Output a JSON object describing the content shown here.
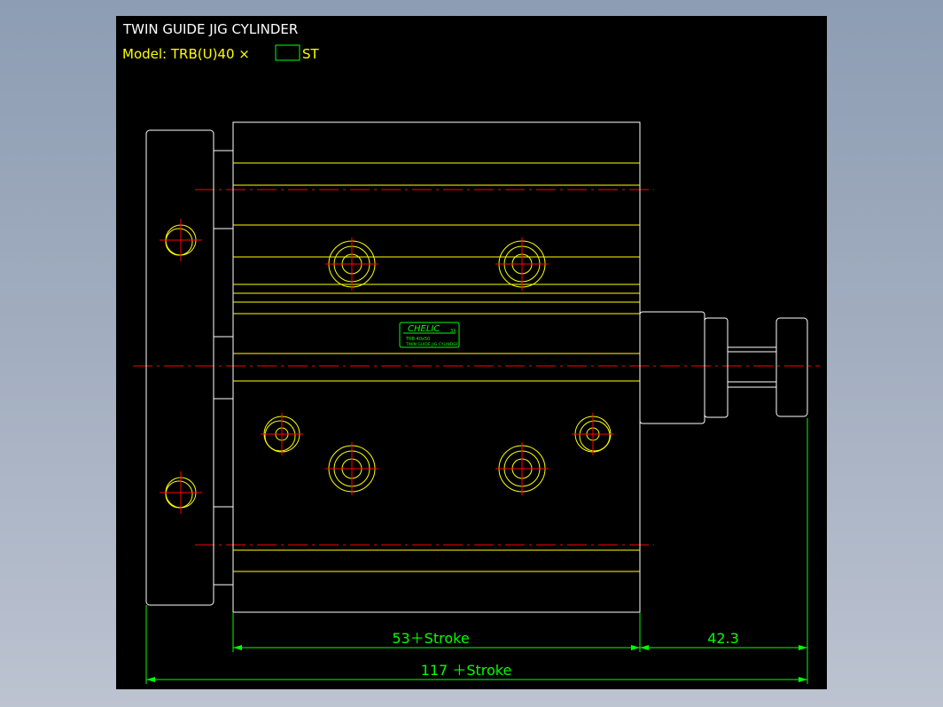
{
  "title": {
    "line1": "TWIN  GUIDE  JIG  CYLINDER",
    "model_prefix": "Model:  TRB(U)40 ×",
    "model_suffix": "ST"
  },
  "nameplate": {
    "brand": "CHELIC",
    "badge": "3X",
    "model_line": "TRB 40x50",
    "desc_line": "TWIN GUIDE JIG CYLINDER"
  },
  "dimensions": {
    "body_length": "53＋Stroke",
    "rod_extension": "42.3",
    "overall_length": "117 ＋Stroke"
  },
  "colors": {
    "background": "#000000",
    "outline": "#ffff00",
    "centerline": "#ff0000",
    "dimension": "#00ff00",
    "title_text": "#ffffff",
    "model_text": "#ffff00"
  }
}
